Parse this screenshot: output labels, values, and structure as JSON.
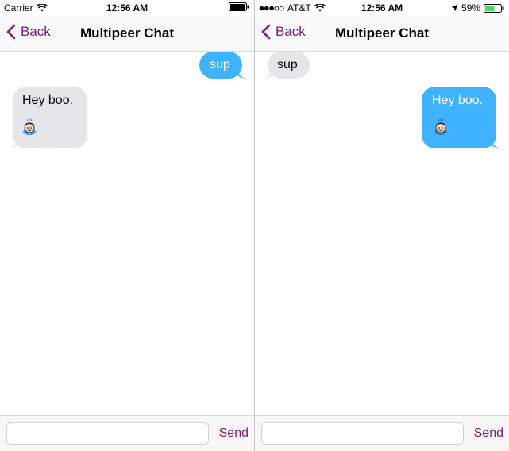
{
  "left": {
    "status": {
      "carrier": "Carrier",
      "time": "12:56 AM"
    },
    "nav": {
      "back_label": "Back",
      "title": "Multipeer Chat"
    },
    "messages": [
      {
        "text": "sup",
        "side": "outgoing"
      },
      {
        "text": "Hey boo.",
        "side": "incoming",
        "emoji": "smiling-face-with-sweat-emoji"
      }
    ],
    "input": {
      "placeholder": "",
      "send_label": "Send"
    }
  },
  "right": {
    "status": {
      "carrier": "AT&T",
      "time": "12:56 AM",
      "battery": "59%"
    },
    "nav": {
      "back_label": "Back",
      "title": "Multipeer Chat"
    },
    "messages": [
      {
        "text": "sup",
        "side": "incoming"
      },
      {
        "text": "Hey boo.",
        "side": "outgoing",
        "emoji": "smiling-face-with-sweat-emoji"
      }
    ],
    "input": {
      "placeholder": "",
      "send_label": "Send"
    }
  },
  "colors": {
    "accent": "#7b1a7f",
    "outgoing_bubble": "#3fb3ff",
    "incoming_bubble": "#e5e5ea"
  }
}
